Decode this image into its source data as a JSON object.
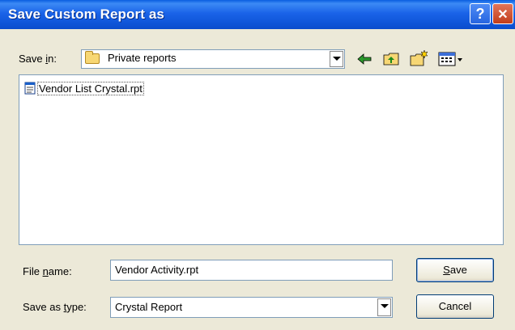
{
  "window": {
    "title": "Save Custom Report as",
    "help_glyph": "?",
    "close_glyph": "✕"
  },
  "toolbar": {
    "save_in_label_pre": "Save ",
    "save_in_label_key": "i",
    "save_in_label_post": "n:",
    "save_in_value": "Private reports",
    "folder_icon": "folder-icon",
    "tools": [
      "back-icon",
      "up-one-level-icon",
      "new-folder-icon",
      "views-menu-icon"
    ]
  },
  "files": [
    {
      "name": "Vendor List Crystal.rpt",
      "icon": "document-icon"
    }
  ],
  "form": {
    "file_name_label_pre": "File ",
    "file_name_label_key": "n",
    "file_name_label_post": "ame:",
    "file_name_value": "Vendor Activity.rpt",
    "save_type_label_pre": "Save as ",
    "save_type_label_key": "t",
    "save_type_label_post": "ype:",
    "save_type_value": "Crystal Report"
  },
  "buttons": {
    "save_key": "S",
    "save_rest": "ave",
    "cancel_label": "Cancel"
  },
  "colors": {
    "titlebar": "#0a5ee0",
    "dialog_bg": "#ece9d8",
    "close": "#c23d1a"
  }
}
